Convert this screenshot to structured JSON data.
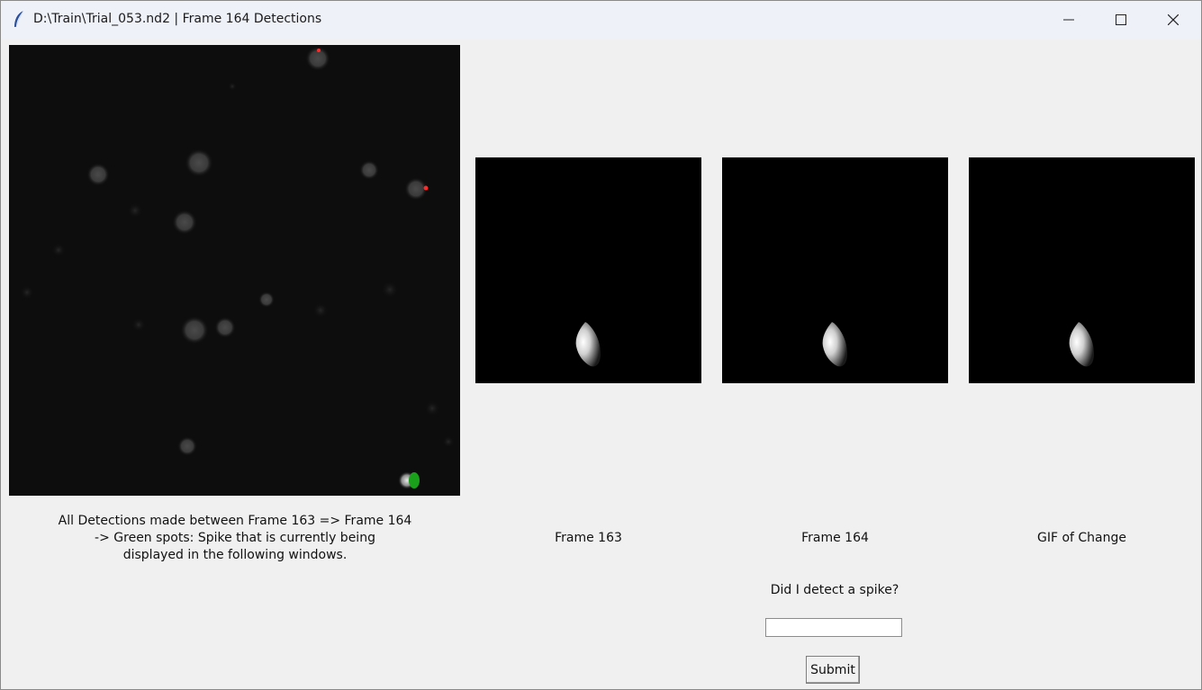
{
  "window": {
    "title": "D:\\Train\\Trial_053.nd2 | Frame 164 Detections",
    "icon": "feather-icon",
    "controls": [
      "minimize-icon",
      "maximize-icon",
      "close-icon"
    ]
  },
  "main_image": {
    "caption_line1": "All Detections made between Frame 163 => Frame 164",
    "caption_line2": "-> Green spots: Spike that is currently being",
    "caption_line3": "displayed in the following windows.",
    "highlight_color": "#1aa01a",
    "marker_color": "#ff2a2a"
  },
  "panels": [
    {
      "label": "Frame 163"
    },
    {
      "label": "Frame 164"
    },
    {
      "label": "GIF of Change"
    }
  ],
  "form": {
    "question": "Did I detect a spike?",
    "answer_value": "",
    "submit_label": "Submit"
  }
}
